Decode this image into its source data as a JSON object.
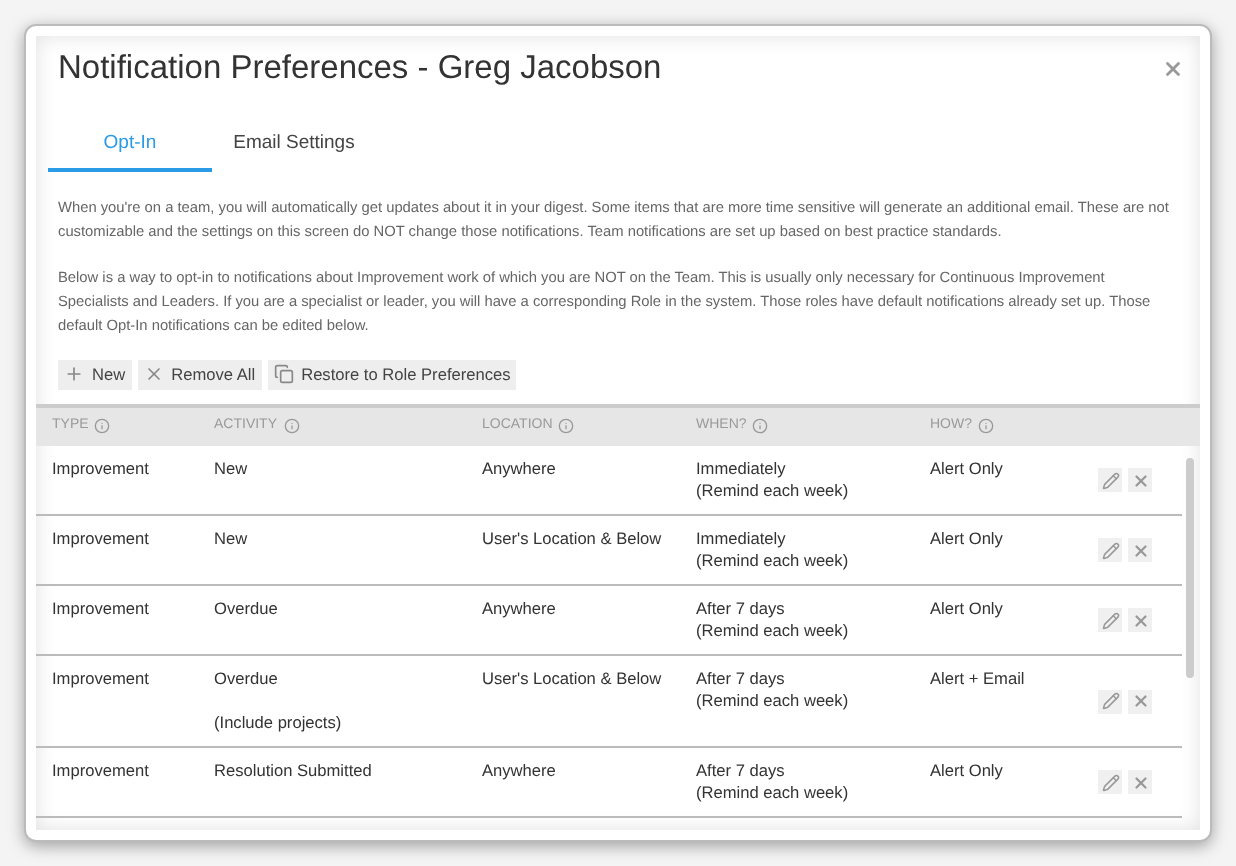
{
  "dialog": {
    "title": "Notification Preferences - Greg Jacobson"
  },
  "tabs": [
    {
      "label": "Opt-In",
      "selected": true
    },
    {
      "label": "Email Settings",
      "selected": false
    }
  ],
  "paragraphs": [
    "When you're on a team, you will automatically get updates about it in your digest. Some items that are more time sensitive will generate an additional email. These are not customizable and the settings on this screen do NOT change those notifications. Team notifications are set up based on best practice standards.",
    "Below is a way to opt-in to notifications about Improvement work of which you are NOT on the Team. This is usually only necessary for Continuous Improvement Specialists and Leaders. If you are a specialist or leader, you will have a corresponding Role in the system. Those roles have default notifications already set up. Those default Opt-In notifications can be edited below."
  ],
  "toolbar": [
    {
      "kind": "new",
      "label": "New"
    },
    {
      "kind": "remove",
      "label": "Remove All"
    },
    {
      "kind": "restore",
      "label": "Restore to Role Preferences"
    }
  ],
  "table": {
    "columns": [
      "TYPE",
      "ACTIVITY",
      "LOCATION",
      "WHEN?",
      "HOW?"
    ],
    "rows": [
      {
        "type": "Improvement",
        "activity": [
          "New"
        ],
        "location": "Anywhere",
        "when": [
          "Immediately",
          "(Remind each week)"
        ],
        "how": "Alert Only"
      },
      {
        "type": "Improvement",
        "activity": [
          "New"
        ],
        "location": "User's Location & Below",
        "when": [
          "Immediately",
          "(Remind each week)"
        ],
        "how": "Alert Only"
      },
      {
        "type": "Improvement",
        "activity": [
          "Overdue"
        ],
        "location": "Anywhere",
        "when": [
          "After 7 days",
          "(Remind each week)"
        ],
        "how": "Alert Only"
      },
      {
        "type": "Improvement",
        "activity": [
          "Overdue",
          "(Include projects)"
        ],
        "location": "User's Location & Below",
        "when": [
          "After 7 days",
          "(Remind each week)"
        ],
        "how": "Alert + Email"
      },
      {
        "type": "Improvement",
        "activity": [
          "Resolution Submitted"
        ],
        "location": "Anywhere",
        "when": [
          "After 7 days",
          "(Remind each week)"
        ],
        "how": "Alert Only"
      }
    ]
  }
}
